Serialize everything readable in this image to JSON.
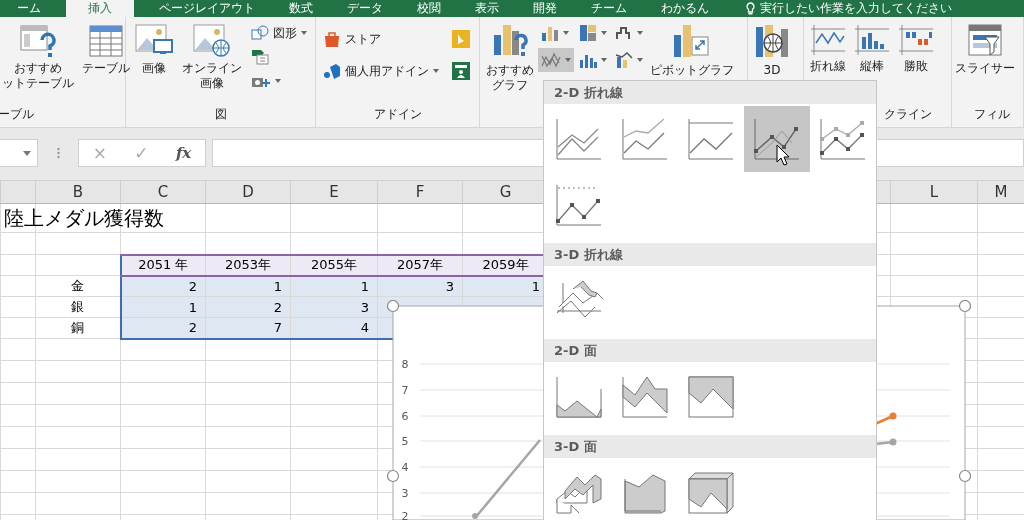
{
  "tabs": [
    {
      "label": "ーム",
      "selected": false
    },
    {
      "label": "挿入",
      "selected": true
    },
    {
      "label": "ページレイアウト",
      "selected": false
    },
    {
      "label": "数式",
      "selected": false
    },
    {
      "label": "データ",
      "selected": false
    },
    {
      "label": "校閲",
      "selected": false
    },
    {
      "label": "表示",
      "selected": false
    },
    {
      "label": "開発",
      "selected": false
    },
    {
      "label": "チーム",
      "selected": false
    },
    {
      "label": "わかるん",
      "selected": false
    }
  ],
  "tell_me": "実行したい作業を入力してください",
  "ribbon": {
    "tables": {
      "label": "ーブル",
      "pivot": [
        "おすすめ",
        "ットテーブル"
      ],
      "table": [
        "テーブル"
      ]
    },
    "illustrations": {
      "label": "図",
      "picture": [
        "画像"
      ],
      "online_picture": [
        "オンライン",
        "画像"
      ],
      "shapes": "図形"
    },
    "addins": {
      "label": "アドイン",
      "store": "ストア",
      "my_addins": "個人用アドイン"
    },
    "charts": {
      "recommended": [
        "おすすめ",
        "グラフ"
      ],
      "line_menu_open": true,
      "pivot_chart": [
        "ピボットグラフ"
      ]
    },
    "tours": {
      "map": [
        "3D"
      ]
    },
    "sparklines": {
      "label": "クライン",
      "line": [
        "折れ線"
      ],
      "column": [
        "縦棒"
      ],
      "win_loss": [
        "勝敗"
      ]
    },
    "filters": {
      "label": "フィル",
      "slicer": [
        "スライサー"
      ]
    }
  },
  "formula_bar": {
    "cancel": "×",
    "enter": "✓",
    "function": "fx"
  },
  "sheet": {
    "columns": [
      "B",
      "C",
      "D",
      "E",
      "F",
      "G",
      "L",
      "M"
    ],
    "title": "陸上メダル獲得数",
    "selected": true,
    "years": [
      "2051 年",
      "2053年",
      "2055年",
      "2057年",
      "2059年"
    ],
    "rows": [
      {
        "label": "金",
        "values": [
          "2",
          "1",
          "1",
          "3",
          "1"
        ]
      },
      {
        "label": "銀",
        "values": [
          "1",
          "2",
          "3"
        ]
      },
      {
        "label": "銅",
        "values": [
          "2",
          "7",
          "4"
        ]
      }
    ]
  },
  "chart": {
    "axis_labels": [
      "8",
      "7",
      "6",
      "5",
      "4",
      "3",
      "2"
    ]
  },
  "gallery": {
    "sections": [
      {
        "title": "2-D 折れ線",
        "items": [
          {
            "selected": false
          },
          {
            "selected": false
          },
          {
            "selected": false
          },
          {
            "selected": true
          },
          {
            "selected": false
          },
          {
            "selected": false
          }
        ]
      },
      {
        "title": "3-D 折れ線",
        "items": [
          {
            "selected": false
          }
        ]
      },
      {
        "title": "2-D 面",
        "items": [
          {
            "selected": false
          },
          {
            "selected": false
          },
          {
            "selected": false
          }
        ]
      },
      {
        "title": "3-D 面",
        "items": [
          {
            "selected": false
          },
          {
            "selected": false
          },
          {
            "selected": false
          }
        ]
      }
    ]
  }
}
